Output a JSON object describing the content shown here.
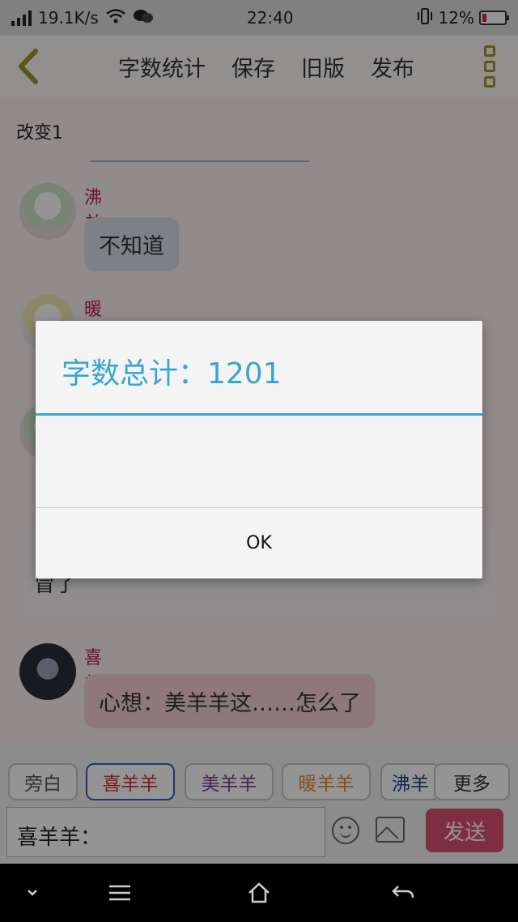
{
  "status_bar": {
    "speed": "19.1K/s",
    "time": "22:40",
    "battery": "12%"
  },
  "header": {
    "actions": [
      "字数统计",
      "保存",
      "旧版",
      "发布"
    ]
  },
  "document": {
    "title": "改变1"
  },
  "messages": [
    {
      "name": "沸羊羊",
      "name_color": "#c2185b",
      "text": "不知道"
    },
    {
      "name": "暖羊羊",
      "name_color": "#c2185b"
    },
    {
      "name": "喜羊羊",
      "name_color": "#c2185b",
      "text": "心想：美羊羊这……怎么了"
    }
  ],
  "narration": {
    "tail": "冒了"
  },
  "roles": [
    {
      "label": "旁白",
      "color": "#555555"
    },
    {
      "label": "喜羊羊",
      "color": "#d32f2f"
    },
    {
      "label": "美羊羊",
      "color": "#7b3fa0"
    },
    {
      "label": "暖羊羊",
      "color": "#e08a2c"
    },
    {
      "label": "沸羊",
      "color": "#1f3f8f"
    },
    {
      "label": "更多",
      "color": "#333333"
    }
  ],
  "input": {
    "value": "喜羊羊："
  },
  "send": {
    "label": "发送"
  },
  "dialog": {
    "title": "字数总计：1201",
    "ok_label": "OK"
  },
  "colors": {
    "accent": "#3aa5d1",
    "send": "#d94f72",
    "active_role": "#2f5fc4"
  }
}
